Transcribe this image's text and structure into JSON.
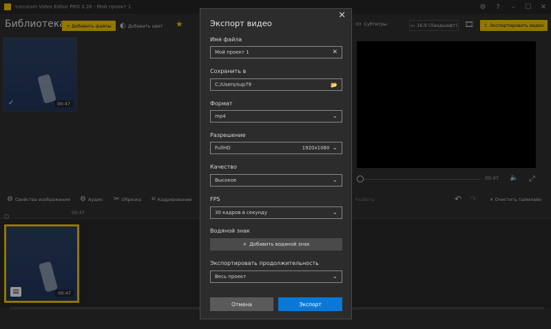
{
  "window": {
    "title": "Icecream Video Editor PRO 3.20  -  Мой проект 1"
  },
  "toolbar": {
    "library_title": "Библиотека",
    "add_files": "Добавить файлы",
    "add_color": "Добавить цвет",
    "subtitles": "Субтитры",
    "aspect": "16:9 (Ландшафт)",
    "export_video": "Экспортировать видео"
  },
  "library": {
    "items": [
      {
        "duration": "00:47"
      }
    ]
  },
  "preview": {
    "time": "00:47"
  },
  "edit_bar": {
    "image_props": "Свойства изображения",
    "audio": "Аудио",
    "trim": "Обрезка",
    "crop": "Кадрирование",
    "split": "Разбить",
    "clear_timeline": "Очистить таймлайн"
  },
  "timeline": {
    "marker": "00:47",
    "clip_duration": "00:47"
  },
  "dialog": {
    "title": "Экспорт видео",
    "file_name_label": "Имя файла",
    "file_name_value": "Мой проект 1",
    "save_to_label": "Сохранить в",
    "save_to_value": "C:/Users/sup79",
    "format_label": "Формат",
    "format_value": "mp4",
    "resolution_label": "Разрешение",
    "resolution_value": "FullHD",
    "resolution_size": "1920x1080",
    "quality_label": "Качество",
    "quality_value": "Высокое",
    "fps_label": "FPS",
    "fps_value": "30 кадров в секунду",
    "watermark_label": "Водяной знак",
    "add_watermark": "Добавить водяной знак",
    "duration_label": "Экспортировать продолжительность",
    "duration_value": "Весь проект",
    "cancel": "Отмена",
    "export": "Экспорт"
  },
  "colors": {
    "accent": "#e1b700",
    "primary_button": "#0a78d6"
  }
}
